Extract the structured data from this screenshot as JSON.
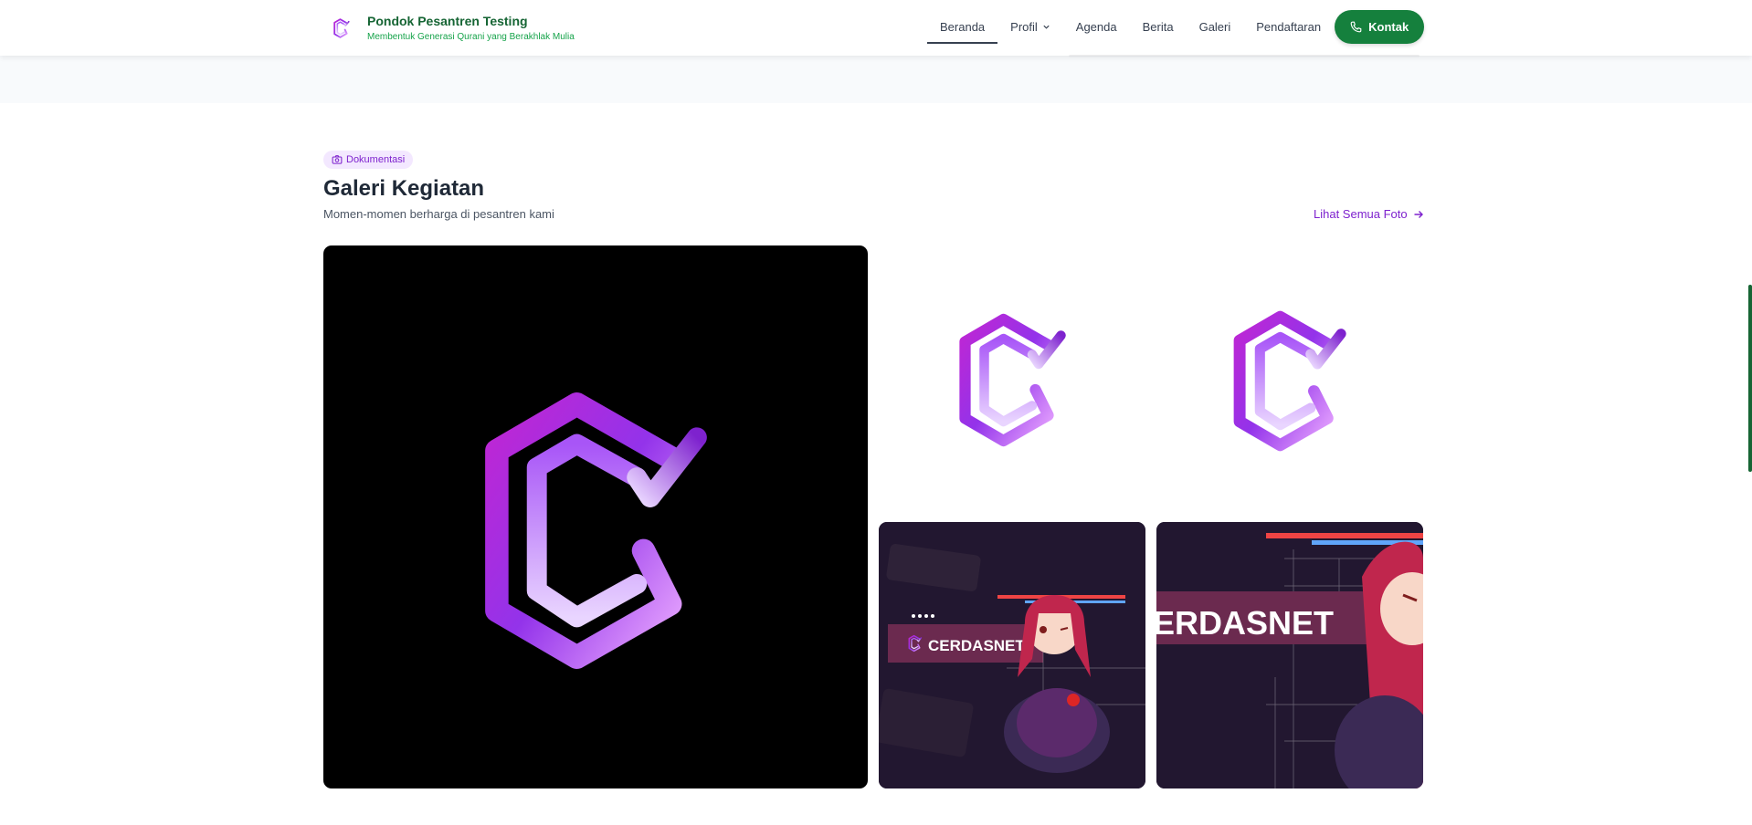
{
  "header": {
    "brand_name": "Pondok Pesantren Testing",
    "brand_tagline": "Membentuk Generasi Qurani yang Berakhlak Mulia",
    "nav": [
      {
        "label": "Beranda",
        "active": true
      },
      {
        "label": "Profil",
        "dropdown": true
      },
      {
        "label": "Agenda"
      },
      {
        "label": "Berita"
      },
      {
        "label": "Galeri"
      },
      {
        "label": "Pendaftaran"
      }
    ],
    "contact_label": "Kontak"
  },
  "gallery": {
    "badge": "Dokumentasi",
    "title": "Galeri Kegiatan",
    "subtitle": "Momen-momen berharga di pesantren kami",
    "see_all": "Lihat Semua Foto",
    "images": [
      {
        "name": "logo-black"
      },
      {
        "name": "logo-white-1"
      },
      {
        "name": "logo-white-2"
      },
      {
        "name": "cerdasnet-banner-1",
        "text": "CERDASNET"
      },
      {
        "name": "cerdasnet-banner-2",
        "text": "ERDASNET"
      }
    ]
  },
  "colors": {
    "brand_green": "#166534",
    "accent_purple": "#7e22ce",
    "button_green": "#15803d"
  },
  "icons": [
    "brand-logo-icon",
    "chevron-down-icon",
    "phone-icon",
    "camera-icon",
    "arrow-right-icon"
  ]
}
